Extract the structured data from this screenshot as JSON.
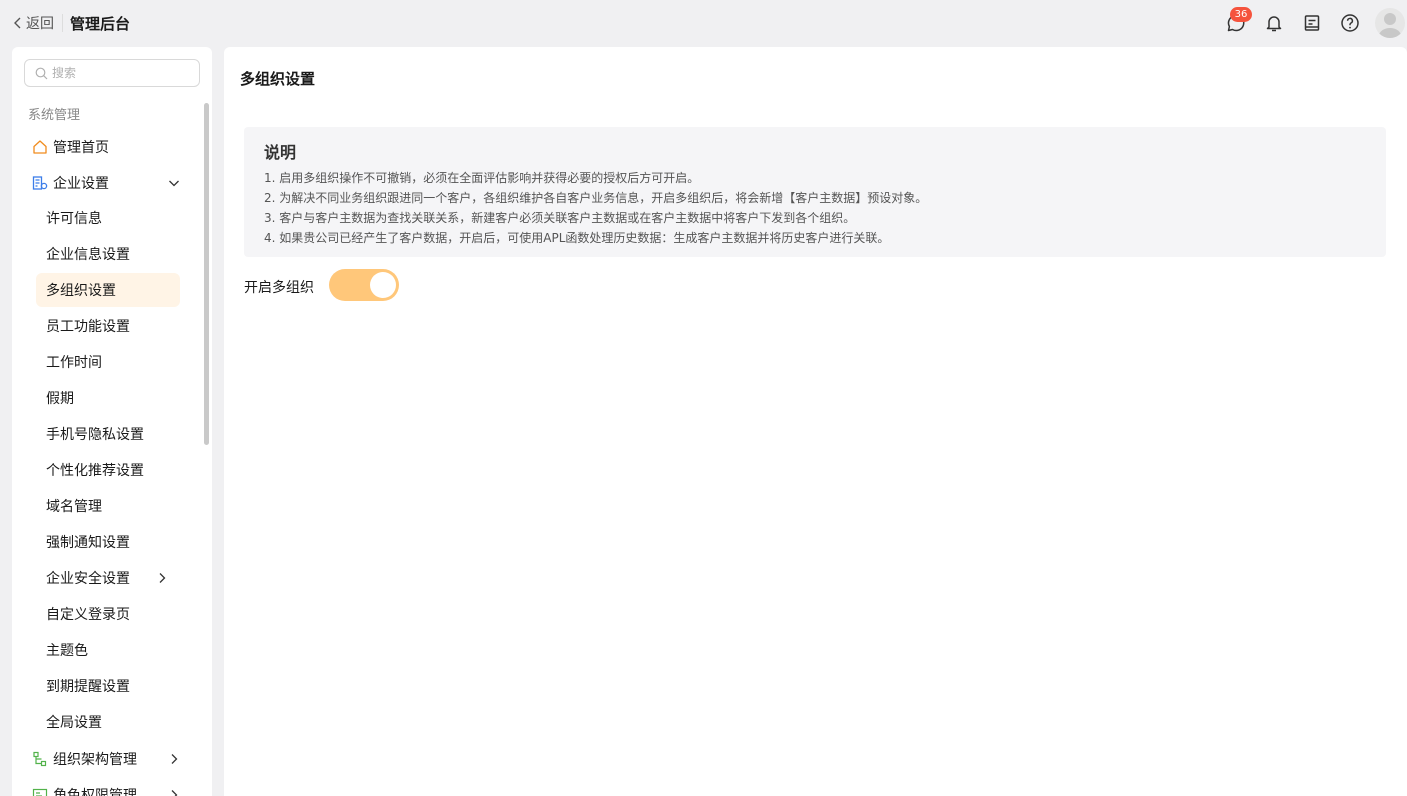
{
  "header": {
    "back_label": "返回",
    "title": "管理后台",
    "notification_count": "36",
    "icons": [
      "chat-icon",
      "bell-icon",
      "document-icon",
      "help-icon",
      "avatar"
    ]
  },
  "sidebar": {
    "search_placeholder": "搜索",
    "section_label": "系统管理",
    "items": [
      {
        "label": "管理首页",
        "icon": "home-icon"
      },
      {
        "label": "企业设置",
        "icon": "enterprise-settings-icon",
        "expanded": true
      },
      {
        "label": "组织架构管理",
        "icon": "org-structure-icon"
      },
      {
        "label": "角色权限管理",
        "icon": "role-permission-icon"
      }
    ],
    "sub_items": [
      {
        "label": "许可信息"
      },
      {
        "label": "企业信息设置"
      },
      {
        "label": "多组织设置",
        "active": true
      },
      {
        "label": "员工功能设置"
      },
      {
        "label": "工作时间"
      },
      {
        "label": "假期"
      },
      {
        "label": "手机号隐私设置"
      },
      {
        "label": "个性化推荐设置"
      },
      {
        "label": "域名管理"
      },
      {
        "label": "强制通知设置"
      },
      {
        "label": "企业安全设置",
        "has_children": true
      },
      {
        "label": "自定义登录页"
      },
      {
        "label": "主题色"
      },
      {
        "label": "到期提醒设置"
      },
      {
        "label": "全局设置"
      }
    ]
  },
  "main": {
    "page_title": "多组织设置",
    "notice": {
      "title": "说明",
      "lines": [
        "1. 启用多组织操作不可撤销，必须在全面评估影响并获得必要的授权后方可开启。",
        "2. 为解决不同业务组织跟进同一个客户，各组织维护各自客户业务信息，开启多组织后，将会新增【客户主数据】预设对象。",
        "3. 客户与客户主数据为查找关联关系，新建客户必须关联客户主数据或在客户主数据中将客户下发到各个组织。",
        "4. 如果贵公司已经产生了客户数据，开启后，可使用APL函数处理历史数据：生成客户主数据并将历史客户进行关联。"
      ]
    },
    "toggle": {
      "label": "开启多组织",
      "on": true
    }
  },
  "colors": {
    "accent": "#ff8000",
    "toggle_on": "#ffc77a",
    "active_bg": "#fff4e6",
    "badge": "#f5533d"
  }
}
